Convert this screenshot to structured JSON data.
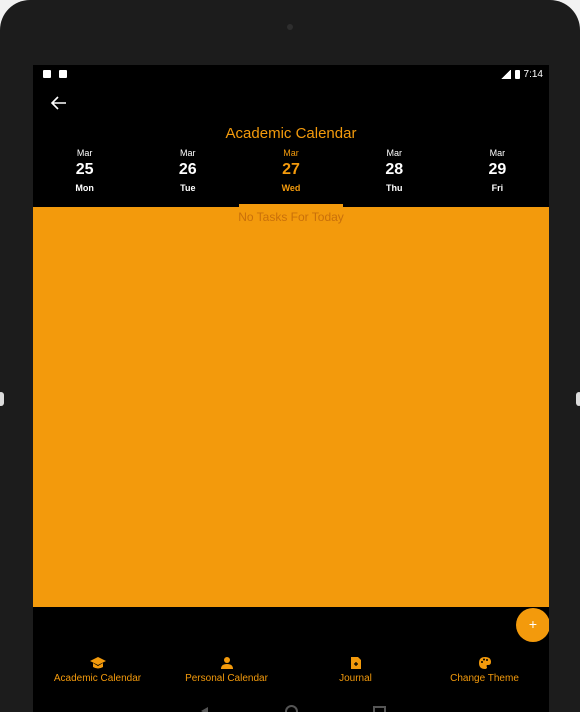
{
  "status_bar": {
    "time": "7:14"
  },
  "header": {
    "title": "Academic Calendar"
  },
  "days": [
    {
      "month": "Mar",
      "day": "25",
      "weekday": "Mon",
      "active": false
    },
    {
      "month": "Mar",
      "day": "26",
      "weekday": "Tue",
      "active": false
    },
    {
      "month": "Mar",
      "day": "27",
      "weekday": "Wed",
      "active": true
    },
    {
      "month": "Mar",
      "day": "28",
      "weekday": "Thu",
      "active": false
    },
    {
      "month": "Mar",
      "day": "29",
      "weekday": "Fri",
      "active": false
    }
  ],
  "tasks": {
    "empty_text": "No Tasks For Today"
  },
  "fab": {
    "label": "+",
    "icon": "plus-icon"
  },
  "bottom_nav": [
    {
      "label": "Academic Calendar",
      "icon": "graduation-cap-icon"
    },
    {
      "label": "Personal Calendar",
      "icon": "person-icon"
    },
    {
      "label": "Journal",
      "icon": "journal-icon"
    },
    {
      "label": "Change Theme",
      "icon": "palette-icon"
    }
  ],
  "colors": {
    "accent": "#f39a0c",
    "background": "#000000",
    "empty_text": "#c9700a"
  }
}
